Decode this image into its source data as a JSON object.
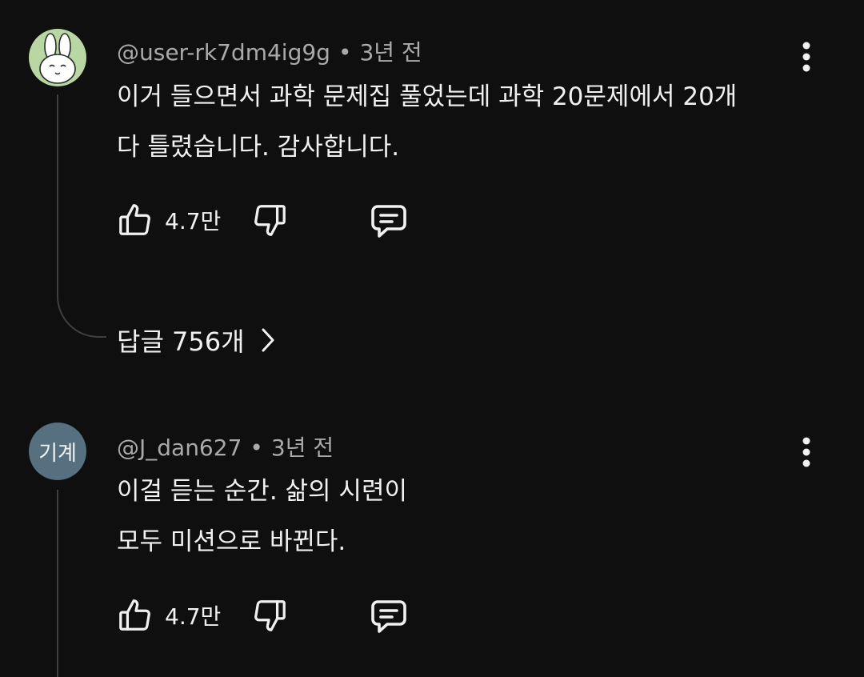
{
  "comments": [
    {
      "author": "@user-rk7dm4ig9g",
      "time": "3년 전",
      "lines": [
        "이거 들으면서 과학 문제집 풀었는데 과학 20문제에서 20개",
        "다 틀렸습니다. 감사합니다."
      ],
      "likes": "4.7만",
      "replies_label": "답글 756개",
      "avatar_icon": "bunny-avatar-icon",
      "avatar_color": "#b9d7a2"
    },
    {
      "author": "@J_dan627",
      "time": "3년 전",
      "avatar_text": "기계",
      "avatar_color": "#56707f",
      "lines": [
        "이걸 듣는 순간. 삶의 시련이",
        "모두 미션으로 바뀐다."
      ],
      "likes": "4.7만"
    }
  ],
  "separator": "•",
  "colors": {
    "background": "#0f0f0f",
    "text": "#f1f1f1",
    "meta": "#aaaaaa",
    "thread": "#3f3f3f"
  }
}
